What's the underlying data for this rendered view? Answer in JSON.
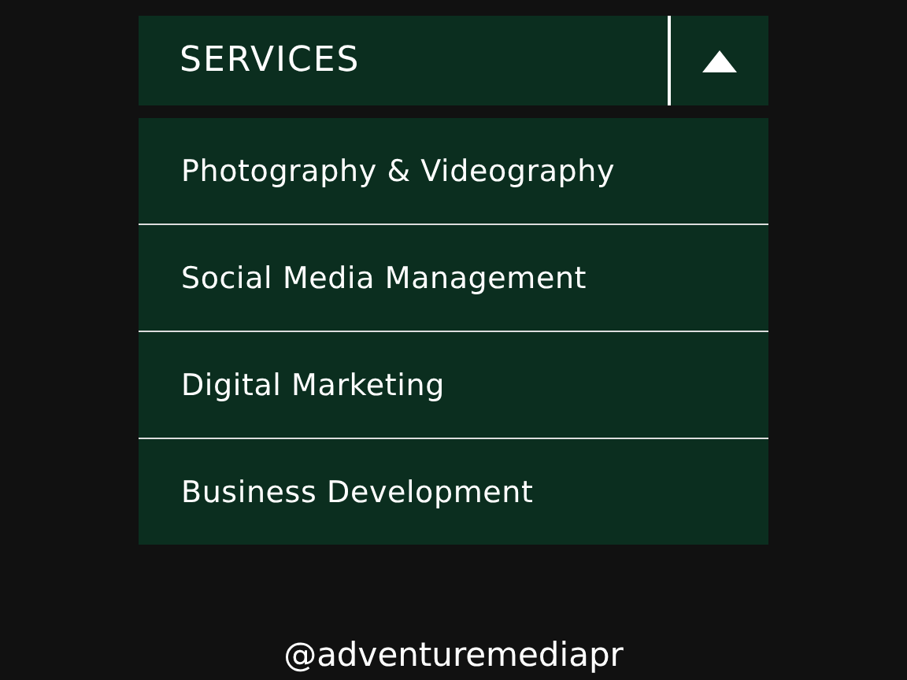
{
  "dropdown": {
    "label": "SERVICES",
    "expanded": true,
    "items": [
      {
        "label": "Photography & Videography"
      },
      {
        "label": "Social Media Management"
      },
      {
        "label": "Digital Marketing"
      },
      {
        "label": "Business Development"
      }
    ]
  },
  "footer": {
    "handle": "@adventuremediapr"
  }
}
